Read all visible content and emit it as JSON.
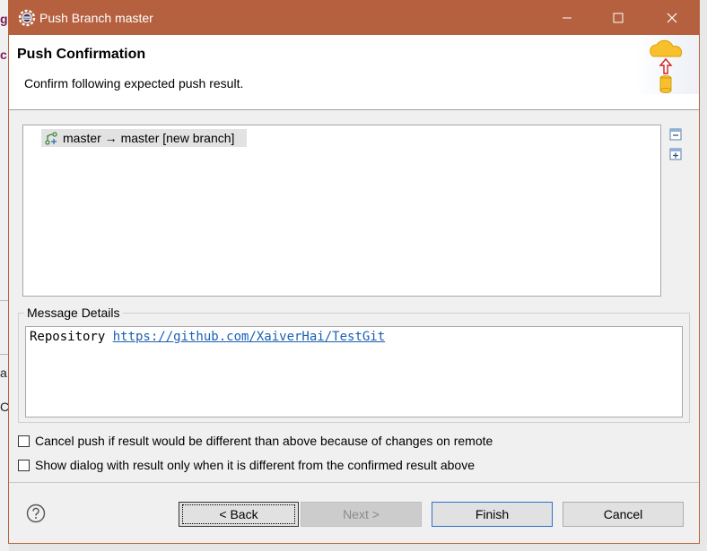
{
  "background": {
    "chars": [
      "g",
      "c",
      "a",
      "C"
    ]
  },
  "window": {
    "title": "Push Branch master",
    "minimize": "—",
    "maximize": "☐",
    "close": "✕"
  },
  "banner": {
    "title": "Push Confirmation",
    "message": "Confirm following expected push result."
  },
  "tree": {
    "items": [
      {
        "label": "master → master [new branch]"
      }
    ]
  },
  "message_details": {
    "legend": "Message Details",
    "prefix": "Repository ",
    "link": "https://github.com/XaiverHai/TestGit"
  },
  "options": {
    "cancel_push": "Cancel push if result would be different than above because of changes on remote",
    "show_dialog": "Show dialog with result only when it is different from the confirmed result above"
  },
  "buttons": {
    "back": "< Back",
    "next": "Next >",
    "finish": "Finish",
    "cancel": "Cancel"
  },
  "colors": {
    "titlebar": "#b5613f",
    "link": "#1a5fb4",
    "focus": "#2b72c9"
  }
}
